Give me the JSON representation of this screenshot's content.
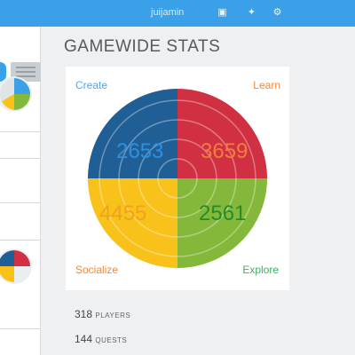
{
  "topbar": {
    "username": "juijamin",
    "icons": [
      "notification-icon",
      "twitter-icon",
      "settings-icon"
    ],
    "color": "#3aa0e8"
  },
  "page": {
    "title": "GAMEWIDE STATS"
  },
  "quadrants": {
    "create": {
      "label": "Create",
      "value": "2653",
      "color": "#1f5f95",
      "label_color": "#55a7e6",
      "value_color": "#2e8fdc"
    },
    "learn": {
      "label": "Learn",
      "value": "3659",
      "color": "#d03042",
      "label_color": "#f08a3a",
      "value_color": "#f07f3c"
    },
    "socialize": {
      "label": "Socialize",
      "value": "4455",
      "color": "#f8c21a",
      "label_color": "#f08a3a",
      "value_color": "#f0a21a"
    },
    "explore": {
      "label": "Explore",
      "value": "2561",
      "color": "#84b83a",
      "label_color": "#3db063",
      "value_color": "#2a8a2a"
    }
  },
  "stats": [
    {
      "value": "318",
      "unit": "PLAYERS"
    },
    {
      "value": "144",
      "unit": "QUESTS"
    }
  ]
}
